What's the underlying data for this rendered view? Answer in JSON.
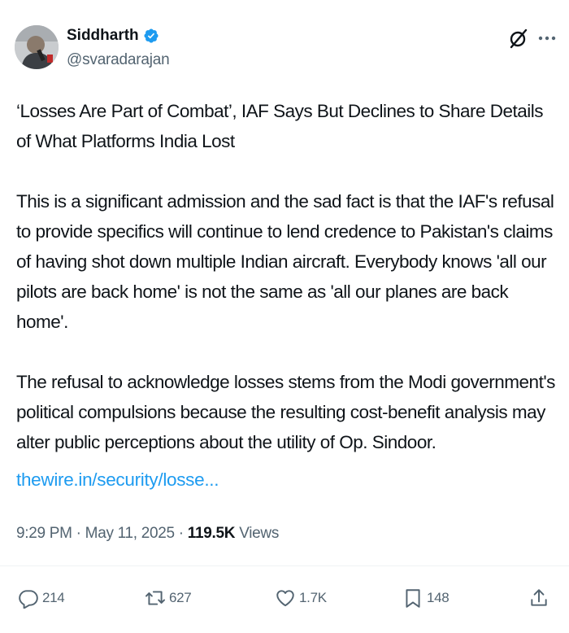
{
  "author": {
    "name": "Siddharth",
    "handle": "@svaradarajan"
  },
  "tweet": {
    "paragraphs": [
      "‘Losses Are Part of Combat’, IAF Says But Declines to Share Details of What Platforms India Lost",
      "This is a significant admission and the sad fact is that the IAF's refusal to provide specifics will continue to lend credence to Pakistan's claims of having shot down multiple Indian aircraft. Everybody knows 'all our pilots are back home' is not the same as 'all our planes are back home'.",
      "The refusal to acknowledge losses stems from the Modi government's political compulsions because the resulting cost-benefit analysis may alter public perceptions about the utility of Op. Sindoor."
    ],
    "link": "thewire.in/security/losse..."
  },
  "meta": {
    "time": "9:29 PM",
    "separator": "·",
    "date": "May 11, 2025",
    "views_count": "119.5K",
    "views_label": "Views"
  },
  "actions": {
    "replies": "214",
    "reposts": "627",
    "likes": "1.7K",
    "bookmarks": "148"
  },
  "icons": {
    "verified": "verified-badge-icon",
    "grok": "grok-icon",
    "more": "more-icon",
    "reply": "reply-icon",
    "repost": "repost-icon",
    "like": "heart-icon",
    "bookmark": "bookmark-icon",
    "share": "share-icon"
  },
  "colors": {
    "link": "#1d9bf0",
    "secondary_text": "#536471",
    "primary_text": "#0f1419",
    "verified": "#1d9bf0"
  }
}
